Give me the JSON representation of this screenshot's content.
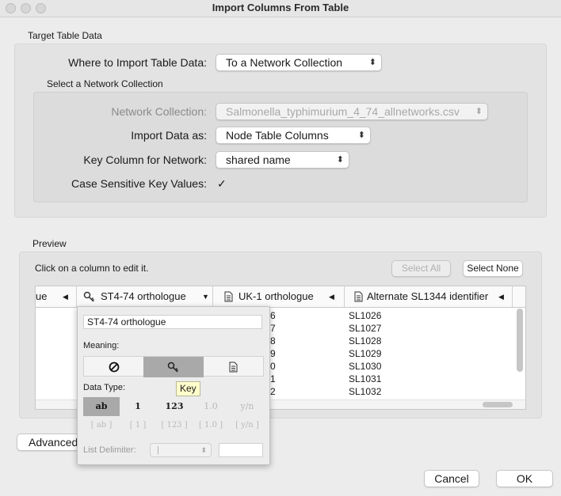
{
  "window": {
    "title": "Import Columns From Table"
  },
  "target": {
    "section_label": "Target Table Data",
    "where_label": "Where to Import Table Data:",
    "where_value": "To a Network Collection",
    "network_section_label": "Select a Network Collection",
    "collection_label": "Network Collection:",
    "collection_value": "Salmonella_typhimurium_4_74_allnetworks.csv",
    "import_as_label": "Import Data as:",
    "import_as_value": "Node Table Columns",
    "key_label": "Key Column for Network:",
    "key_value": "shared name",
    "case_label": "Case Sensitive Key Values:",
    "case_checked": true,
    "case_mark": "✓"
  },
  "preview": {
    "section_label": "Preview",
    "hint": "Click on a column to edit it.",
    "select_all": "Select All",
    "select_none": "Select None",
    "columns": [
      {
        "label": "ue",
        "icon": "text-icon",
        "arrow": "◀"
      },
      {
        "label": "ST4-74 orthologue",
        "icon": "key-icon",
        "arrow": "▼"
      },
      {
        "label": "UK-1 orthologue",
        "icon": "document-icon",
        "arrow": "◀"
      },
      {
        "label": "Alternate SL1344 identifier",
        "icon": "document-icon",
        "arrow": "◀"
      }
    ],
    "rows": [
      {
        "c3": "6",
        "c4": "SL1026"
      },
      {
        "c3": "7",
        "c4": "SL1027"
      },
      {
        "c3": "8",
        "c4": "SL1028"
      },
      {
        "c3": "9",
        "c4": "SL1029"
      },
      {
        "c3": "0",
        "c4": "SL1030"
      },
      {
        "c3": "1",
        "c4": "SL1031"
      },
      {
        "c3": "2",
        "c4": "SL1032"
      }
    ]
  },
  "editor": {
    "column_name": "ST4-74 orthologue",
    "meaning_label": "Meaning:",
    "meaning_options": [
      "none",
      "key",
      "attribute"
    ],
    "meaning_selected": "key",
    "tooltip": "Key",
    "data_type_label": "Data Type:",
    "types": [
      "ab",
      "1",
      "123",
      "1.0",
      "y/n"
    ],
    "list_types": [
      "[ ab ]",
      "[ 1 ]",
      "[ 123 ]",
      "[ 1.0 ]",
      "[ y/n ]"
    ],
    "type_selected": "ab",
    "list_delimiter_label": "List Delimiter:",
    "list_delimiter_value": "|"
  },
  "footer": {
    "advanced": "Advanced",
    "cancel": "Cancel",
    "ok": "OK"
  }
}
